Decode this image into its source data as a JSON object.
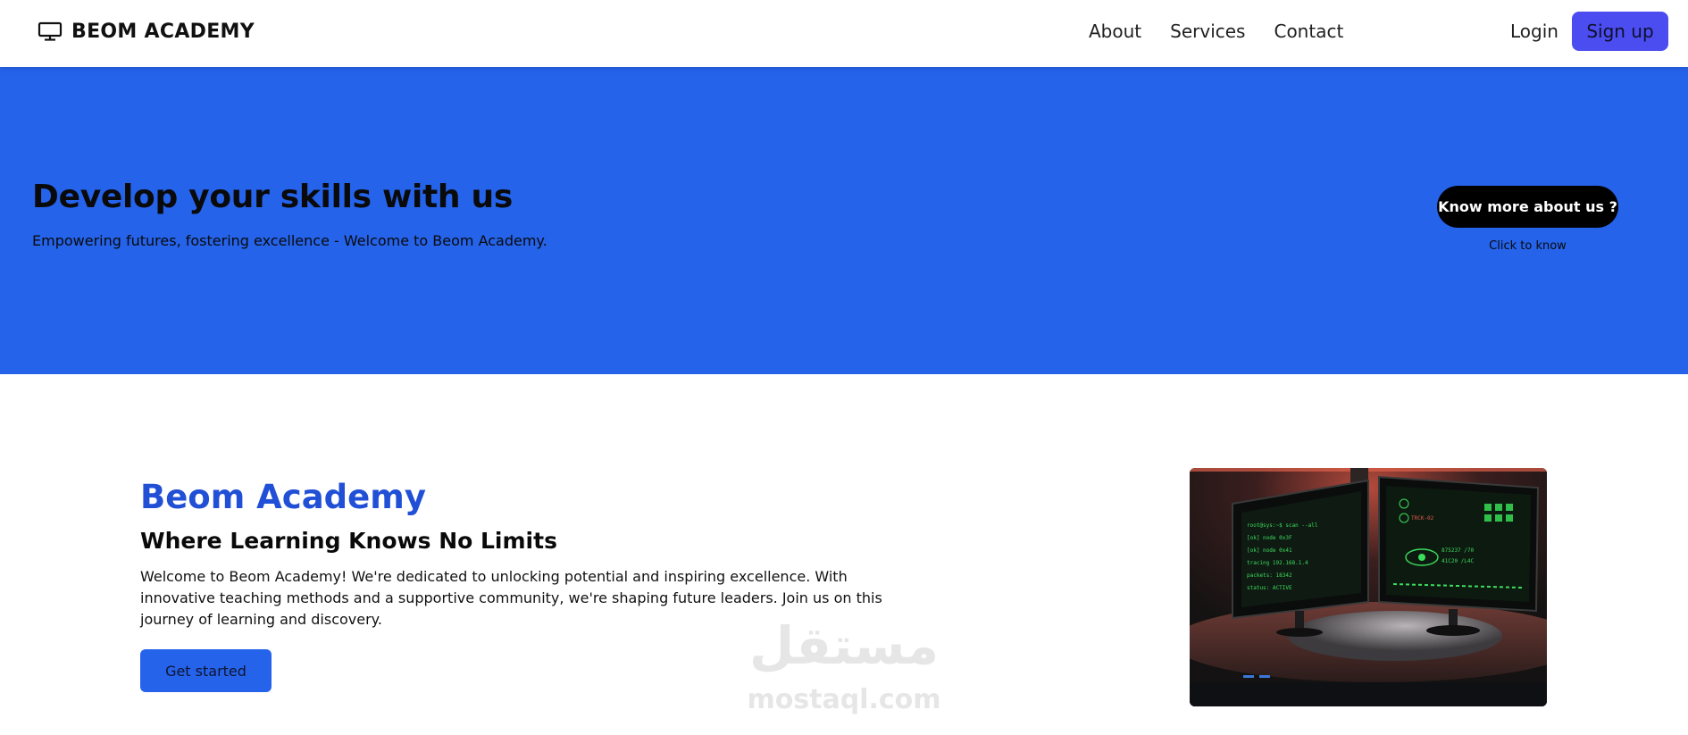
{
  "navbar": {
    "brand": "BEOM ACADEMY",
    "brand_icon": "monitor-icon",
    "links": [
      "About",
      "Services",
      "Contact"
    ],
    "login_label": "Login",
    "signup_label": "Sign up",
    "signup_color": "#4b4df0"
  },
  "hero": {
    "background_color": "#2563eb",
    "title": "Develop your skills with us",
    "subtitle": "Empowering futures, fostering excellence - Welcome to Beom Academy.",
    "cta_label": "Know more about us ?",
    "cta_hint": "Click to know"
  },
  "intro": {
    "heading": "Beom Academy",
    "heading_color": "#2150d6",
    "subheading": "Where Learning Knows No Limits",
    "body": "Welcome to Beom Academy! We're dedicated to unlocking potential and inspiring excellence. With innovative teaching methods and a supportive community, we're shaping future leaders. Join us on this journey of learning and discovery.",
    "button_label": "Get started"
  },
  "watermark": {
    "arabic": "مستقل",
    "latin": "mostaql.com"
  },
  "photo": {
    "screen1_lines": [
      "root@sys:~$ scan --all",
      "[ok] node 0x3F",
      "[ok] node 0x41",
      "tracing 192.168.1.4",
      "packets: 18342",
      "status: ACTIVE"
    ],
    "screen2_lines": [
      "TRCK-02",
      "875237 /70",
      "41C20 /L4C"
    ]
  }
}
